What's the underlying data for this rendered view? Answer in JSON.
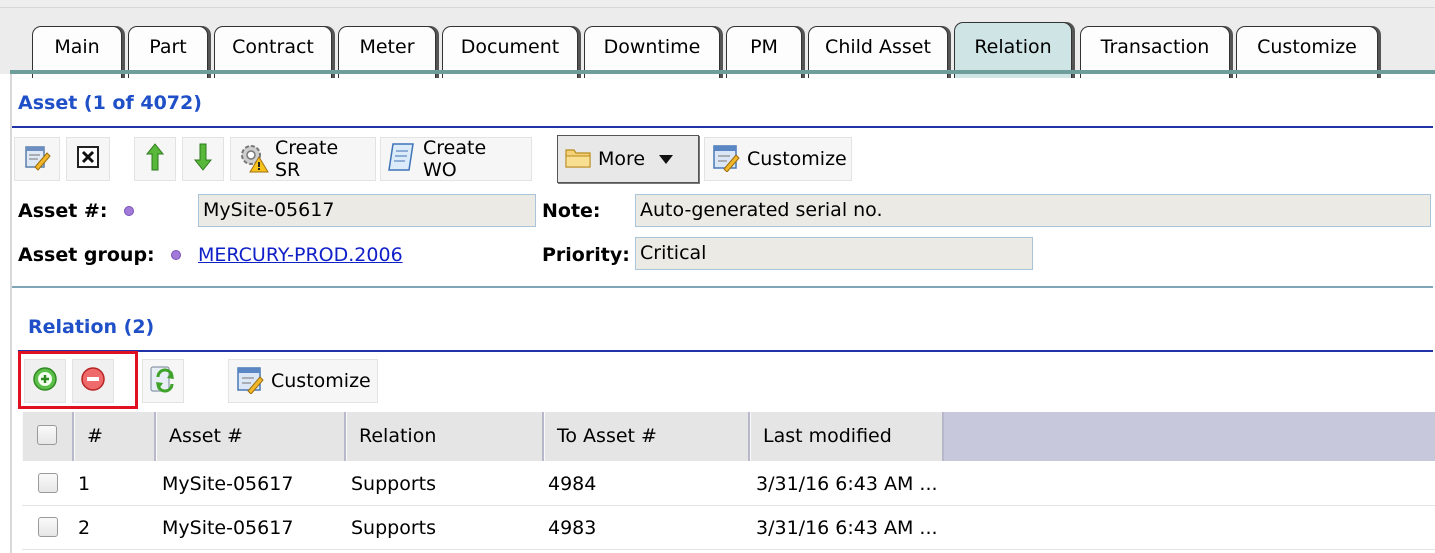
{
  "tabs": [
    {
      "label": "Main"
    },
    {
      "label": "Part"
    },
    {
      "label": "Contract"
    },
    {
      "label": "Meter"
    },
    {
      "label": "Document"
    },
    {
      "label": "Downtime"
    },
    {
      "label": "PM"
    },
    {
      "label": "Child Asset"
    },
    {
      "label": "Relation",
      "active": true
    },
    {
      "label": "Transaction"
    },
    {
      "label": "Customize"
    }
  ],
  "asset": {
    "title": "Asset (1 of 4072)",
    "toolbar": {
      "create_sr": "Create SR",
      "create_wo": "Create WO",
      "more": "More",
      "customize": "Customize"
    },
    "fields": {
      "asset_no_label": "Asset #:",
      "asset_no_value": "MySite-05617",
      "asset_group_label": "Asset group:",
      "asset_group_value": "MERCURY-PROD.2006",
      "note_label": "Note:",
      "note_value": "Auto-generated serial no.",
      "priority_label": "Priority:",
      "priority_value": "Critical"
    }
  },
  "relation": {
    "title": "Relation (2)",
    "toolbar": {
      "customize": "Customize"
    },
    "columns": [
      "#",
      "Asset #",
      "Relation",
      "To Asset #",
      "Last modified"
    ],
    "rows": [
      {
        "num": "1",
        "asset": "MySite-05617",
        "relation": "Supports",
        "to_asset": "4984",
        "modified": "3/31/16 6:43 AM ..."
      },
      {
        "num": "2",
        "asset": "MySite-05617",
        "relation": "Supports",
        "to_asset": "4983",
        "modified": "3/31/16 6:43 AM ..."
      }
    ]
  },
  "colors": {
    "section_title": "#1f50c8",
    "active_tab": "#cfe4e4",
    "highlight_box": "#e01020",
    "field_dot": "#a27ad8"
  },
  "icons": [
    "edit-icon",
    "delete-icon",
    "arrow-up-icon",
    "arrow-down-icon",
    "gear-warning-icon",
    "scroll-icon",
    "folder-icon",
    "dropdown-arrow-icon",
    "customize-icon",
    "add-icon",
    "remove-icon",
    "refresh-icon"
  ]
}
